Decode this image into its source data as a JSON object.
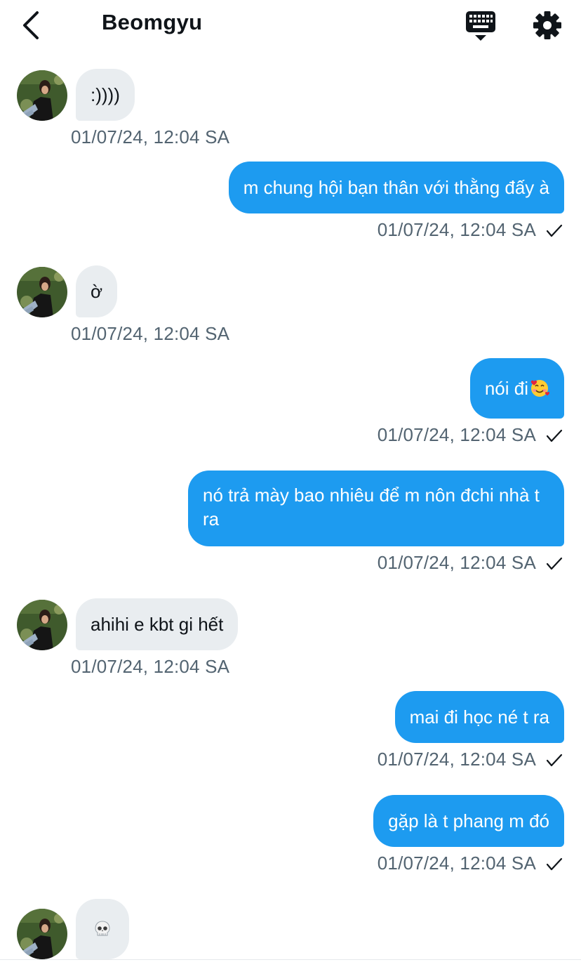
{
  "header": {
    "title": "Beomgyu",
    "back_icon": "chevron-left-icon",
    "keyboard_icon": "keyboard-icon",
    "settings_icon": "gear-icon"
  },
  "colors": {
    "outgoing_bubble": "#1d9bf0",
    "incoming_bubble": "#e9edf0",
    "timestamp": "#536471"
  },
  "messages": [
    {
      "from": "them",
      "text": ":))))",
      "time": "01/07/24, 12:04 SA"
    },
    {
      "from": "me",
      "text": "m chung hội bạn thân với thằng đấy à",
      "time": "01/07/24, 12:04 SA",
      "status": "sent-check-icon"
    },
    {
      "from": "them",
      "text": "ờ",
      "time": "01/07/24, 12:04 SA"
    },
    {
      "from": "me",
      "text": "nói đi",
      "emoji": "smiling-face-with-hearts",
      "time": "01/07/24, 12:04 SA",
      "status": "sent-check-icon"
    },
    {
      "from": "me",
      "text": "nó trả mày bao nhiêu để m nôn đchi nhà t ra",
      "time": "01/07/24, 12:04 SA",
      "status": "sent-check-icon"
    },
    {
      "from": "them",
      "text": "ahihi e kbt gi hết",
      "time": "01/07/24, 12:04 SA"
    },
    {
      "from": "me",
      "text": "mai đi học né t ra",
      "time": "01/07/24, 12:04 SA",
      "status": "sent-check-icon"
    },
    {
      "from": "me",
      "text": "gặp là t phang m đó",
      "time": "01/07/24, 12:04 SA",
      "status": "sent-check-icon"
    },
    {
      "from": "them",
      "text": "",
      "emoji": "skull",
      "time": ""
    }
  ]
}
